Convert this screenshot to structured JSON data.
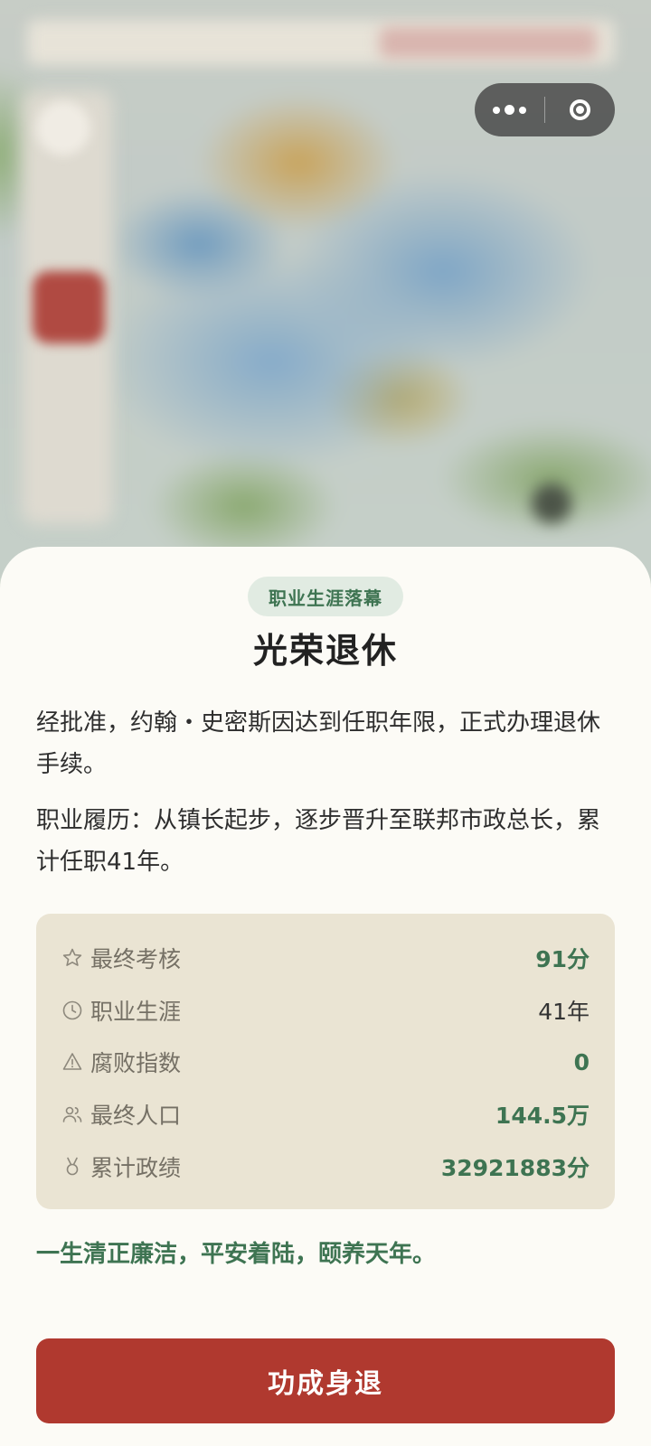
{
  "colors": {
    "accent_green": "#3e7452",
    "badge_bg": "#e1ebe2",
    "panel_bg": "#eae4d3",
    "button_red": "#b0392f",
    "sheet_bg": "#fcfbf6"
  },
  "capsule": {
    "more_icon": "more-dots-icon",
    "close_icon": "target-circle-icon"
  },
  "sheet": {
    "badge": "职业生涯落幕",
    "title": "光荣退休",
    "paragraph1": "经批准，约翰・史密斯因达到任职年限，正式办理退休手续。",
    "paragraph2": "职业履历：从镇长起步，逐步晋升至联邦市政总长，累计任职41年。",
    "stats": [
      {
        "icon": "star-icon",
        "label": "最终考核",
        "value": "91分"
      },
      {
        "icon": "clock-icon",
        "label": "职业生涯",
        "value": "41年"
      },
      {
        "icon": "warning-icon",
        "label": "腐败指数",
        "value": "0"
      },
      {
        "icon": "users-icon",
        "label": "最终人口",
        "value": "144.5万"
      },
      {
        "icon": "medal-icon",
        "label": "累计政绩",
        "value": "32921883分"
      }
    ],
    "motto": "一生清正廉洁，平安着陆，颐养天年。",
    "button": "功成身退"
  }
}
